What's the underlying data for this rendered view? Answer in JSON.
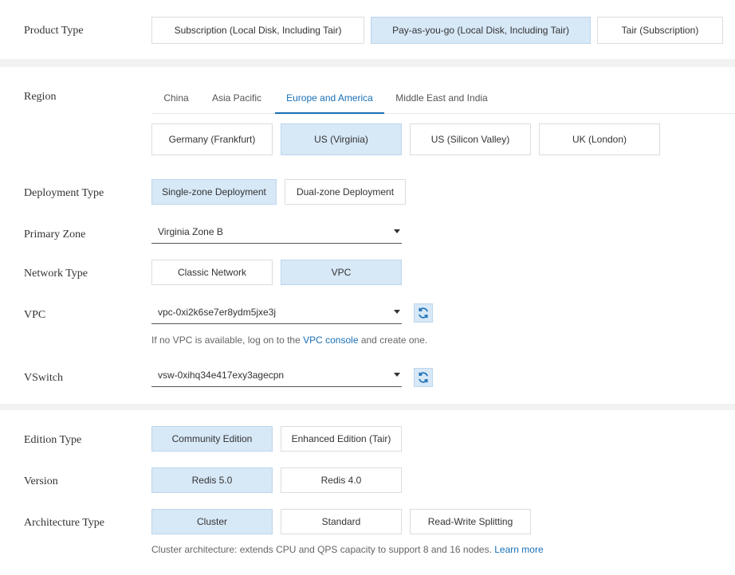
{
  "product_type": {
    "label": "Product Type",
    "options": [
      "Subscription (Local Disk, Including Tair)",
      "Pay-as-you-go (Local Disk, Including Tair)",
      "Tair (Subscription)"
    ],
    "selected": 1
  },
  "region": {
    "label": "Region",
    "tabs": [
      "China",
      "Asia Pacific",
      "Europe and America",
      "Middle East and India"
    ],
    "active_tab": 2,
    "options": [
      "Germany (Frankfurt)",
      "US (Virginia)",
      "US (Silicon Valley)",
      "UK (London)"
    ],
    "selected": 1
  },
  "deployment_type": {
    "label": "Deployment Type",
    "options": [
      "Single-zone Deployment",
      "Dual-zone Deployment"
    ],
    "selected": 0
  },
  "primary_zone": {
    "label": "Primary Zone",
    "value": "Virginia Zone B"
  },
  "network_type": {
    "label": "Network Type",
    "options": [
      "Classic Network",
      "VPC"
    ],
    "selected": 1
  },
  "vpc": {
    "label": "VPC",
    "value": "vpc-0xi2k6se7er8ydm5jxe3j",
    "hint_prefix": "If no VPC is available, log on to the ",
    "hint_link": "VPC console",
    "hint_suffix": " and create one."
  },
  "vswitch": {
    "label": "VSwitch",
    "value": "vsw-0xihq34e417exy3agecpn"
  },
  "edition_type": {
    "label": "Edition Type",
    "options": [
      "Community Edition",
      "Enhanced Edition (Tair)"
    ],
    "selected": 0
  },
  "version": {
    "label": "Version",
    "options": [
      "Redis 5.0",
      "Redis 4.0"
    ],
    "selected": 0
  },
  "architecture_type": {
    "label": "Architecture Type",
    "options": [
      "Cluster",
      "Standard",
      "Read-Write Splitting"
    ],
    "selected": 0,
    "hint_text": "Cluster architecture: extends CPU and QPS capacity to support 8 and 16 nodes. ",
    "hint_link": "Learn more"
  },
  "colors": {
    "accent": "#1a6fb5",
    "selected_bg": "#d7e8f7",
    "page_bg": "#f2f2f2"
  }
}
